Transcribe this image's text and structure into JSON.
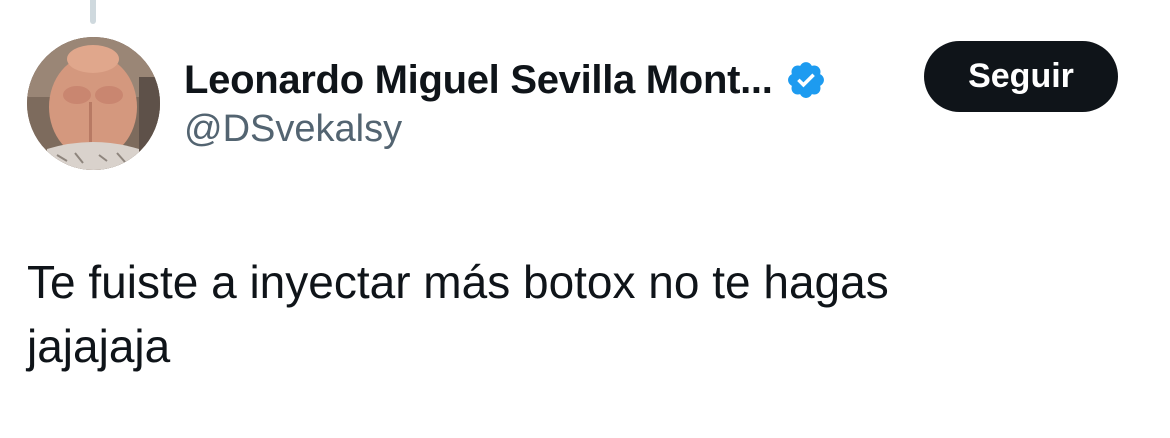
{
  "author": {
    "display_name": "Leonardo Miguel Sevilla Mont...",
    "handle": "@DSvekalsy",
    "verified": true,
    "avatar_icon": "profile-photo"
  },
  "actions": {
    "follow_label": "Seguir"
  },
  "tweet": {
    "lines": [
      "Te fuiste a inyectar más botox no te hagas",
      "jajajaja"
    ]
  },
  "colors": {
    "verified_badge": "#1d9bf0",
    "follow_button_bg": "#0f1419",
    "handle_text": "#536471",
    "thread_line": "#cfd9de"
  }
}
